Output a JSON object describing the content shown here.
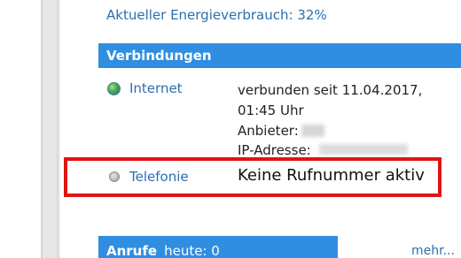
{
  "energy_text": "Aktueller Energieverbrauch: 32%",
  "connections": {
    "title": "Verbindungen",
    "internet": {
      "label": "Internet",
      "status_icon": "globe-icon",
      "detail_line1": "verbunden seit 11.04.2017,",
      "detail_line2": "01:45 Uhr",
      "provider_label": "Anbieter:",
      "ip_label": "IP-Adresse:"
    },
    "telefonie": {
      "label": "Telefonie",
      "status_icon": "gray-status-dot-icon",
      "status": "Keine Rufnummer aktiv"
    }
  },
  "calls": {
    "title": "Anrufe",
    "today": "heute: 0",
    "more_link": "mehr..."
  },
  "colors": {
    "accent": "#2f8ee0",
    "link": "#2a6fb0",
    "highlight": "#e01414"
  }
}
